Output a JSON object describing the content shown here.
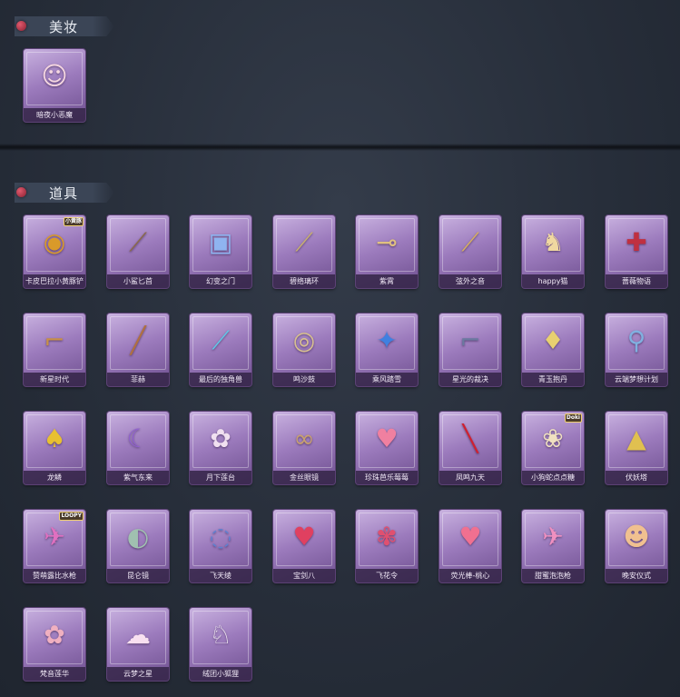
{
  "sections": {
    "makeup": {
      "title": "美妆",
      "items": [
        {
          "label": "暗夜小恶魔",
          "icon": "☺",
          "icon_name": "devil-girl-portrait-icon",
          "color": "#f4d6e0"
        }
      ]
    },
    "props": {
      "title": "道具",
      "items": [
        {
          "label": "卡皮巴拉小黄豚铲",
          "icon": "◉",
          "icon_name": "capybara-shovel-icon",
          "color": "#d99a2a",
          "badge": "小黄豚"
        },
        {
          "label": "小鲨匕首",
          "icon": "⟋",
          "icon_name": "shark-dagger-icon",
          "color": "#8a6a4a"
        },
        {
          "label": "幻变之门",
          "icon": "▣",
          "icon_name": "phantom-door-icon",
          "color": "#8fb4f0"
        },
        {
          "label": "碧络璃环",
          "icon": "⟋",
          "icon_name": "jade-ring-staff-icon",
          "color": "#c8b070"
        },
        {
          "label": "紫霄",
          "icon": "⊸",
          "icon_name": "purple-sky-scepter-icon",
          "color": "#e0c080"
        },
        {
          "label": "弦外之音",
          "icon": "⟋",
          "icon_name": "string-instrument-icon",
          "color": "#d8b060"
        },
        {
          "label": "happy猫",
          "icon": "♞",
          "icon_name": "happy-cat-icon",
          "color": "#f0d8a0"
        },
        {
          "label": "蔷薇物语",
          "icon": "✚",
          "icon_name": "first-aid-box-icon",
          "color": "#c03040"
        },
        {
          "label": "新星时代",
          "icon": "⌐",
          "icon_name": "revolver-icon",
          "color": "#c89048"
        },
        {
          "label": "菲赫",
          "icon": "╱",
          "icon_name": "spear-icon",
          "color": "#b07040"
        },
        {
          "label": "最后的独角兽",
          "icon": "⟋",
          "icon_name": "unicorn-blade-icon",
          "color": "#60c8e8"
        },
        {
          "label": "鸣沙鼓",
          "icon": "◎",
          "icon_name": "sand-drum-icon",
          "color": "#d8c090"
        },
        {
          "label": "乘风踏雪",
          "icon": "✦",
          "icon_name": "wind-snow-skates-icon",
          "color": "#4080e0"
        },
        {
          "label": "星光的裁决",
          "icon": "⌐",
          "icon_name": "star-rifle-icon",
          "color": "#6a7aa0"
        },
        {
          "label": "青玉抱丹",
          "icon": "♦",
          "icon_name": "jade-gourd-icon",
          "color": "#e8d070"
        },
        {
          "label": "云端梦想计划",
          "icon": "⚲",
          "icon_name": "cloud-hammer-icon",
          "color": "#80b0e0"
        },
        {
          "label": "龙鳞",
          "icon": "♠",
          "icon_name": "golden-shovel-icon",
          "color": "#e8c030"
        },
        {
          "label": "紫气东来",
          "icon": "☾",
          "icon_name": "purple-crescent-staff-icon",
          "color": "#9060d0"
        },
        {
          "label": "月下莲台",
          "icon": "✿",
          "icon_name": "lotus-mirror-icon",
          "color": "#f0e0f0"
        },
        {
          "label": "金丝眼镜",
          "icon": "∞",
          "icon_name": "gold-glasses-icon",
          "color": "#c8a070"
        },
        {
          "label": "珍珠芭乐莓莓",
          "icon": "♥",
          "icon_name": "berry-drink-icon",
          "color": "#f080a0"
        },
        {
          "label": "凤鸣九天",
          "icon": "╲",
          "icon_name": "phoenix-blade-icon",
          "color": "#d02030"
        },
        {
          "label": "小狗蛇点点糖",
          "icon": "❀",
          "icon_name": "puppy-candy-icon",
          "color": "#f0e0c0",
          "badge": "Doki"
        },
        {
          "label": "伏妖塔",
          "icon": "▲",
          "icon_name": "demon-tower-icon",
          "color": "#e0c050"
        },
        {
          "label": "赞萌露比水枪",
          "icon": "✈",
          "icon_name": "water-gun-icon",
          "color": "#e070c0",
          "badge": "LOOPY"
        },
        {
          "label": "昆仑镜",
          "icon": "◐",
          "icon_name": "kunlun-mirror-icon",
          "color": "#a0c0b0"
        },
        {
          "label": "飞天绫",
          "icon": "◌",
          "icon_name": "flying-ribbon-icon",
          "color": "#6080d0"
        },
        {
          "label": "宝剑八",
          "icon": "♥",
          "icon_name": "heart-card-icon",
          "color": "#e04060"
        },
        {
          "label": "飞花令",
          "icon": "✾",
          "icon_name": "flower-bouquet-icon",
          "color": "#e05070"
        },
        {
          "label": "荧光棒-桃心",
          "icon": "♥",
          "icon_name": "heart-glowstick-icon",
          "color": "#f07090"
        },
        {
          "label": "甜蜜泡泡枪",
          "icon": "✈",
          "icon_name": "bubble-gun-icon",
          "color": "#f090c0"
        },
        {
          "label": "晚安仪式",
          "icon": "☻",
          "icon_name": "piggy-doll-icon",
          "color": "#f0c090"
        },
        {
          "label": "梵音莲华",
          "icon": "✿",
          "icon_name": "lotus-doll-icon",
          "color": "#f0b0c0"
        },
        {
          "label": "云梦之星",
          "icon": "☁",
          "icon_name": "cloud-star-icon",
          "color": "#f8e0f0"
        },
        {
          "label": "绒团小狐狸",
          "icon": "♘",
          "icon_name": "fluffy-fox-icon",
          "color": "#f0e8f0"
        }
      ]
    }
  }
}
